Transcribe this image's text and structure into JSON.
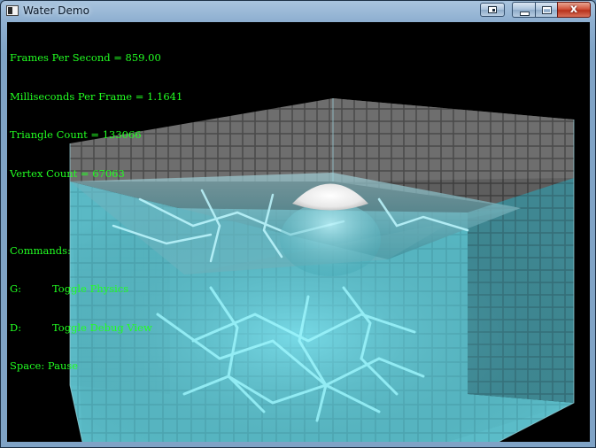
{
  "window": {
    "title": "Water Demo",
    "close_glyph": "x",
    "icons": [
      "app-icon",
      "extra-button-icon",
      "minimize-icon",
      "maximize-icon",
      "close-icon"
    ]
  },
  "hud": {
    "fps": "Frames Per Second = 859.00",
    "ms_per_frame": "Milliseconds Per Frame = 1.1641",
    "triangle_count": "Triangle Count = 133066",
    "vertex_count": "Vertex Count = 67063",
    "commands_header": "Commands:",
    "commands": [
      {
        "key": "G:",
        "action": "Toggle Physics"
      },
      {
        "key": "D:",
        "action": "Toggle Debug View"
      },
      {
        "key": "Space:",
        "action": "Pause"
      }
    ],
    "color": "#22ff22"
  },
  "scene": {
    "water_color": "#3cc6d8",
    "tile_color": "#4fb2bf",
    "upper_wall_color": "#7a7a7a"
  }
}
